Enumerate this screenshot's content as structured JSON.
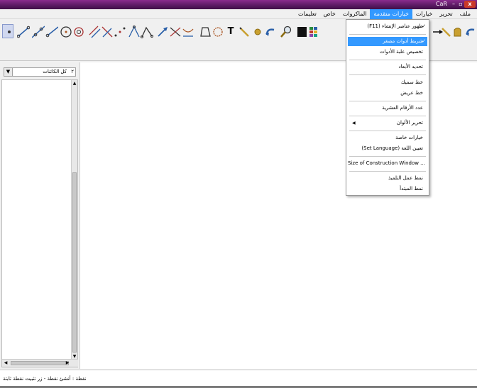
{
  "window": {
    "title": "CaR"
  },
  "menubar": {
    "items": [
      "ملف",
      "تحرير",
      "خيارات",
      "خيارات متقدمة",
      "الماكروات",
      "خاص",
      "تعليمات"
    ],
    "active_index": 3
  },
  "toolbar": {
    "tools": [
      "point-tool-icon",
      "segment-icon",
      "line-icon",
      "ray-icon",
      "vector-icon",
      "circle-icon",
      "compass-icon",
      "parallel-icon",
      "perpendicular-icon",
      "midpoint-icon",
      "angle-icon",
      "fixed-angle-icon",
      "move-icon",
      "intersection-icon",
      "polygon-icon",
      "text-tool-icon",
      "pencil-icon",
      "delete-icon",
      "undo-icon",
      "zoom-icon",
      "color-black-icon",
      "color-palette-icon"
    ],
    "text_tool_label": "T"
  },
  "left_panel": {
    "combo_value": "كل الكائنات",
    "combo_number": "٢"
  },
  "dropdown": {
    "items": [
      {
        "label": "(F11) ظهور عناصر الإنشاء",
        "checked": true,
        "selected": false
      },
      {
        "label": "شريط أدوات مصغر",
        "checked": true,
        "selected": true
      },
      {
        "label": "تخصيص علبة الأدوات",
        "checked": false,
        "selected": false
      },
      {
        "label": "تحديد الأبعاد",
        "checked": false,
        "selected": false
      },
      {
        "label": "خط سميك",
        "checked": false,
        "selected": false
      },
      {
        "label": "خط عريض",
        "checked": false,
        "selected": false
      },
      {
        "label": "عدد الأرقام العشرية",
        "checked": false,
        "selected": false
      },
      {
        "label": "تحرير الألوان",
        "checked": false,
        "selected": false,
        "submenu": true
      },
      {
        "label": "خيارات خاصة",
        "checked": false,
        "selected": false
      },
      {
        "label": "(Set Language) تعيين اللغة",
        "checked": false,
        "selected": false
      },
      {
        "label": "Size of Construction Window ...",
        "checked": false,
        "selected": false
      },
      {
        "label": "نمط عمل التلميذ",
        "checked": false,
        "selected": false
      },
      {
        "label": "نمط المبتدأ",
        "checked": false,
        "selected": false
      }
    ]
  },
  "status_bar": {
    "text": "نقطة : أنشئ نقطة - زر تثبيت نقطة ثابتة"
  },
  "colors": {
    "accent": "#3399ff",
    "title_bar": "#5a1a62",
    "close_button": "#c9382a"
  }
}
